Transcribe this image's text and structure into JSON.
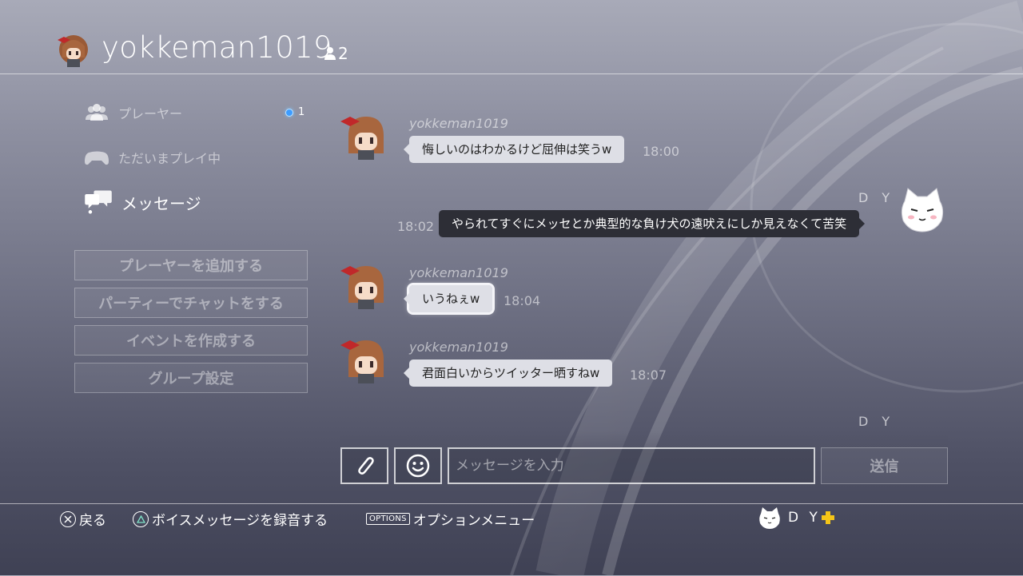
{
  "header": {
    "title": "yokkeman1019",
    "member_count": "2"
  },
  "sidebar": {
    "nav": [
      {
        "label": "プレーヤー",
        "icon": "players-icon",
        "badge": "1"
      },
      {
        "label": "ただいまプレイ中",
        "icon": "controller-icon"
      },
      {
        "label": "メッセージ",
        "icon": "message-bubbles-icon",
        "active": true
      }
    ],
    "buttons": [
      {
        "label": "プレーヤーを追加する"
      },
      {
        "label": "パーティーでチャットをする"
      },
      {
        "label": "イベントを作成する"
      },
      {
        "label": "グループ設定"
      }
    ]
  },
  "messages": [
    {
      "sender": "yokkeman1019",
      "text": "悔しいのはわかるけど屈伸は笑うw",
      "time": "18:00",
      "direction": "in"
    },
    {
      "sender": "D Y",
      "text": "やられてすぐにメッセとか典型的な負け犬の遠吠えにしか見えなくて苦笑",
      "time": "18:02",
      "direction": "out"
    },
    {
      "sender": "yokkeman1019",
      "text": "いうねぇw",
      "time": "18:04",
      "direction": "in",
      "selected": true
    },
    {
      "sender": "yokkeman1019",
      "text": "君面白いからツイッター晒すねw",
      "time": "18:07",
      "direction": "in"
    },
    {
      "sender": "D Y",
      "direction": "out",
      "partial": true
    }
  ],
  "composer": {
    "attach_icon": "paperclip-icon",
    "emoji_icon": "smiley-icon",
    "placeholder": "メッセージを入力",
    "send_label": "送信"
  },
  "footer": {
    "back": {
      "button": "cross",
      "label": "戻る"
    },
    "voice": {
      "button": "triangle",
      "label": "ボイスメッセージを録音する"
    },
    "options": {
      "badge": "OPTIONS",
      "label": "オプションメニュー"
    },
    "user": {
      "name": "D Y",
      "plus_icon": "ps-plus-icon",
      "plus_color": "#f5c518"
    }
  },
  "colors": {
    "badge_blue": "#3d9cff",
    "bubble_in": "#dedfe6",
    "bubble_out": "#2d2e36"
  }
}
